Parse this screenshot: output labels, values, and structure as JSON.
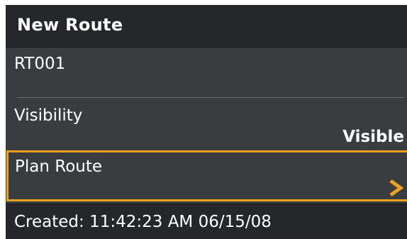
{
  "dialog": {
    "title": "New Route"
  },
  "route": {
    "name": "RT001"
  },
  "visibility": {
    "label": "Visibility",
    "value": "Visible"
  },
  "plan_route": {
    "label": "Plan Route",
    "icon": "chevron-right-icon",
    "highlight_color": "#f0a020"
  },
  "footer": {
    "created_text": "Created: 11:42:23 AM 06/15/08"
  }
}
